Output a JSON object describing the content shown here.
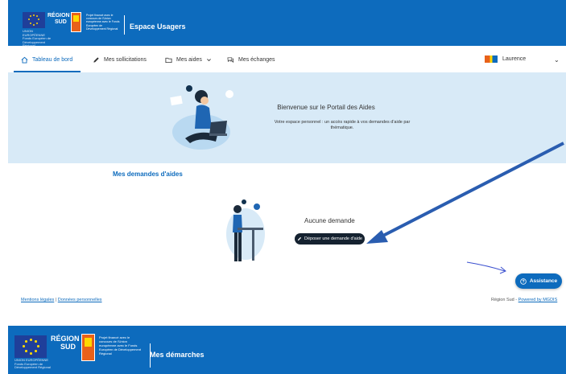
{
  "header": {
    "eu_caption": "UNION EUROPÉENNE Fonds Européen de Développement Régional",
    "region_line1": "RÉGION",
    "region_line2": "SUD",
    "project_text": "Projet financé avec le concours de l'Union européenne avec le Fonds Européen de Développement Régional",
    "app_title": "Espace Usagers"
  },
  "nav": {
    "items": [
      {
        "label": "Tableau de bord"
      },
      {
        "label": "Mes sollicitations"
      },
      {
        "label": "Mes aides"
      },
      {
        "label": "Mes échanges"
      }
    ],
    "user_name": "Laurence"
  },
  "hero": {
    "title": "Bienvenue sur le Portail des Aides",
    "subtitle": "Votre espace personnel : un accès rapide à vos demandes d'aide par thématique."
  },
  "demandes": {
    "section_title": "Mes demandes d'aides",
    "empty_text": "Aucune demande",
    "button_label": "Déposer une demande d'aide"
  },
  "assistance": {
    "label": "Assistance"
  },
  "footer": {
    "mentions": "Mentions légales",
    "separator": "|",
    "donnees": "Données personnelles",
    "right_prefix": "Région Sud -",
    "powered": "Powered by MGDIS"
  },
  "banner2": {
    "eu_caption": "UNION EUROPÉENNE Fonds Européen de Développement Régional",
    "region_line1": "RÉGION",
    "region_line2": "SUD",
    "project_text": "Projet financé avec le concours de l'Union européenne avec le Fonds Européen de Développement Régional",
    "app_title": "Mes démarches"
  },
  "colors": {
    "brand_blue": "#0d6bbd",
    "hero_bg": "#d8eaf7",
    "button_dark": "#152230",
    "arrow_blue": "#2a5db0"
  },
  "icons": [
    "home-icon",
    "pencil-icon",
    "folder-icon",
    "chevron-down-icon",
    "chat-icon",
    "question-icon"
  ]
}
